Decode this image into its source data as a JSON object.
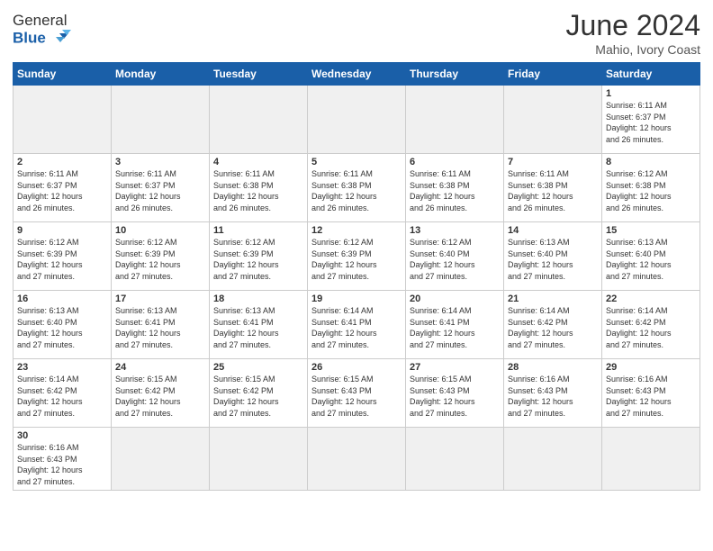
{
  "header": {
    "logo_general": "General",
    "logo_blue": "Blue",
    "month_year": "June 2024",
    "location": "Mahio, Ivory Coast"
  },
  "weekdays": [
    "Sunday",
    "Monday",
    "Tuesday",
    "Wednesday",
    "Thursday",
    "Friday",
    "Saturday"
  ],
  "days": {
    "1": {
      "sunrise": "6:11 AM",
      "sunset": "6:37 PM",
      "daylight": "12 hours and 26 minutes."
    },
    "2": {
      "sunrise": "6:11 AM",
      "sunset": "6:37 PM",
      "daylight": "12 hours and 26 minutes."
    },
    "3": {
      "sunrise": "6:11 AM",
      "sunset": "6:37 PM",
      "daylight": "12 hours and 26 minutes."
    },
    "4": {
      "sunrise": "6:11 AM",
      "sunset": "6:38 PM",
      "daylight": "12 hours and 26 minutes."
    },
    "5": {
      "sunrise": "6:11 AM",
      "sunset": "6:38 PM",
      "daylight": "12 hours and 26 minutes."
    },
    "6": {
      "sunrise": "6:11 AM",
      "sunset": "6:38 PM",
      "daylight": "12 hours and 26 minutes."
    },
    "7": {
      "sunrise": "6:11 AM",
      "sunset": "6:38 PM",
      "daylight": "12 hours and 26 minutes."
    },
    "8": {
      "sunrise": "6:12 AM",
      "sunset": "6:38 PM",
      "daylight": "12 hours and 26 minutes."
    },
    "9": {
      "sunrise": "6:12 AM",
      "sunset": "6:39 PM",
      "daylight": "12 hours and 27 minutes."
    },
    "10": {
      "sunrise": "6:12 AM",
      "sunset": "6:39 PM",
      "daylight": "12 hours and 27 minutes."
    },
    "11": {
      "sunrise": "6:12 AM",
      "sunset": "6:39 PM",
      "daylight": "12 hours and 27 minutes."
    },
    "12": {
      "sunrise": "6:12 AM",
      "sunset": "6:39 PM",
      "daylight": "12 hours and 27 minutes."
    },
    "13": {
      "sunrise": "6:12 AM",
      "sunset": "6:40 PM",
      "daylight": "12 hours and 27 minutes."
    },
    "14": {
      "sunrise": "6:13 AM",
      "sunset": "6:40 PM",
      "daylight": "12 hours and 27 minutes."
    },
    "15": {
      "sunrise": "6:13 AM",
      "sunset": "6:40 PM",
      "daylight": "12 hours and 27 minutes."
    },
    "16": {
      "sunrise": "6:13 AM",
      "sunset": "6:40 PM",
      "daylight": "12 hours and 27 minutes."
    },
    "17": {
      "sunrise": "6:13 AM",
      "sunset": "6:41 PM",
      "daylight": "12 hours and 27 minutes."
    },
    "18": {
      "sunrise": "6:13 AM",
      "sunset": "6:41 PM",
      "daylight": "12 hours and 27 minutes."
    },
    "19": {
      "sunrise": "6:14 AM",
      "sunset": "6:41 PM",
      "daylight": "12 hours and 27 minutes."
    },
    "20": {
      "sunrise": "6:14 AM",
      "sunset": "6:41 PM",
      "daylight": "12 hours and 27 minutes."
    },
    "21": {
      "sunrise": "6:14 AM",
      "sunset": "6:42 PM",
      "daylight": "12 hours and 27 minutes."
    },
    "22": {
      "sunrise": "6:14 AM",
      "sunset": "6:42 PM",
      "daylight": "12 hours and 27 minutes."
    },
    "23": {
      "sunrise": "6:14 AM",
      "sunset": "6:42 PM",
      "daylight": "12 hours and 27 minutes."
    },
    "24": {
      "sunrise": "6:15 AM",
      "sunset": "6:42 PM",
      "daylight": "12 hours and 27 minutes."
    },
    "25": {
      "sunrise": "6:15 AM",
      "sunset": "6:42 PM",
      "daylight": "12 hours and 27 minutes."
    },
    "26": {
      "sunrise": "6:15 AM",
      "sunset": "6:43 PM",
      "daylight": "12 hours and 27 minutes."
    },
    "27": {
      "sunrise": "6:15 AM",
      "sunset": "6:43 PM",
      "daylight": "12 hours and 27 minutes."
    },
    "28": {
      "sunrise": "6:16 AM",
      "sunset": "6:43 PM",
      "daylight": "12 hours and 27 minutes."
    },
    "29": {
      "sunrise": "6:16 AM",
      "sunset": "6:43 PM",
      "daylight": "12 hours and 27 minutes."
    },
    "30": {
      "sunrise": "6:16 AM",
      "sunset": "6:43 PM",
      "daylight": "12 hours and 27 minutes."
    }
  },
  "labels": {
    "sunrise": "Sunrise:",
    "sunset": "Sunset:",
    "daylight": "Daylight:"
  }
}
